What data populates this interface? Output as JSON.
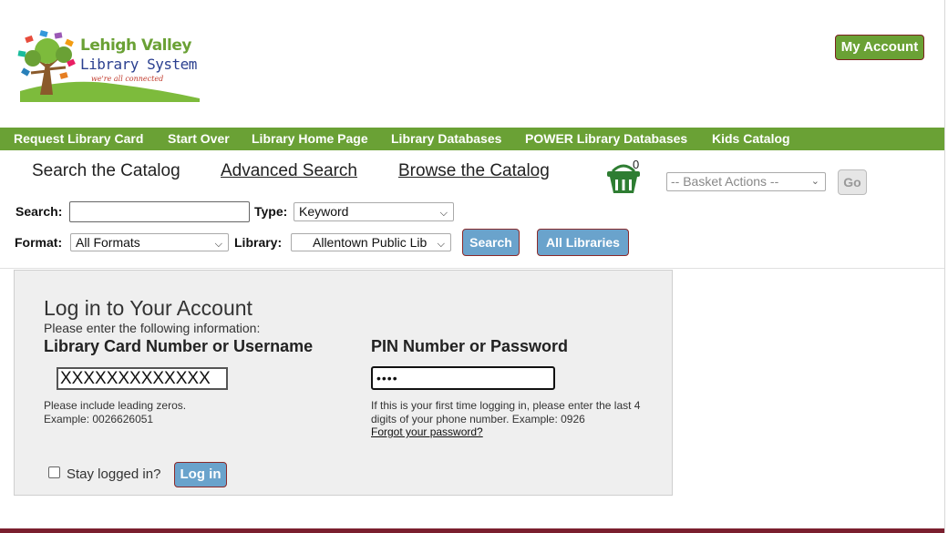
{
  "header": {
    "logo_line1": "Lehigh Valley",
    "logo_line2": "Library System",
    "logo_tagline": "we're all connected",
    "my_account_label": "My Account"
  },
  "nav": {
    "items": [
      {
        "label": "Request Library Card"
      },
      {
        "label": "Start Over"
      },
      {
        "label": "Library Home Page"
      },
      {
        "label": "Library Databases"
      },
      {
        "label": "POWER Library Databases"
      },
      {
        "label": "Kids Catalog"
      }
    ]
  },
  "tabs": {
    "search_catalog": "Search the Catalog",
    "advanced_search": "Advanced Search",
    "browse_catalog": "Browse the Catalog"
  },
  "basket": {
    "count": "0",
    "actions_placeholder": "-- Basket Actions --",
    "go_label": "Go",
    "icon": "basket-icon"
  },
  "search": {
    "search_label": "Search:",
    "search_value": "",
    "type_label": "Type:",
    "type_value": "Keyword",
    "format_label": "Format:",
    "format_value": "All Formats",
    "library_label": "Library:",
    "library_value": "Allentown Public Lib",
    "search_button": "Search",
    "all_libraries_button": "All Libraries"
  },
  "login": {
    "title": "Log in to Your Account",
    "subtitle": "Please enter the following information:",
    "card_label": "Library Card Number or Username",
    "card_value": "XXXXXXXXXXXXX",
    "pin_label": "PIN Number or Password",
    "pin_value": "••••",
    "card_help_1": "Please include leading zeros.",
    "card_help_2": "Example: 0026626051",
    "pin_help_1": "If this is your first time logging in, please enter the last 4",
    "pin_help_2": "digits of your phone number. Example: 0926",
    "forgot_label": "Forgot your password?",
    "stay_logged_label": "Stay logged in?",
    "stay_logged_checked": false,
    "login_button": "Log in"
  },
  "colors": {
    "brand_green": "#6aa135",
    "button_blue": "#6aa3cc",
    "accent_maroon": "#7a1f2e"
  }
}
